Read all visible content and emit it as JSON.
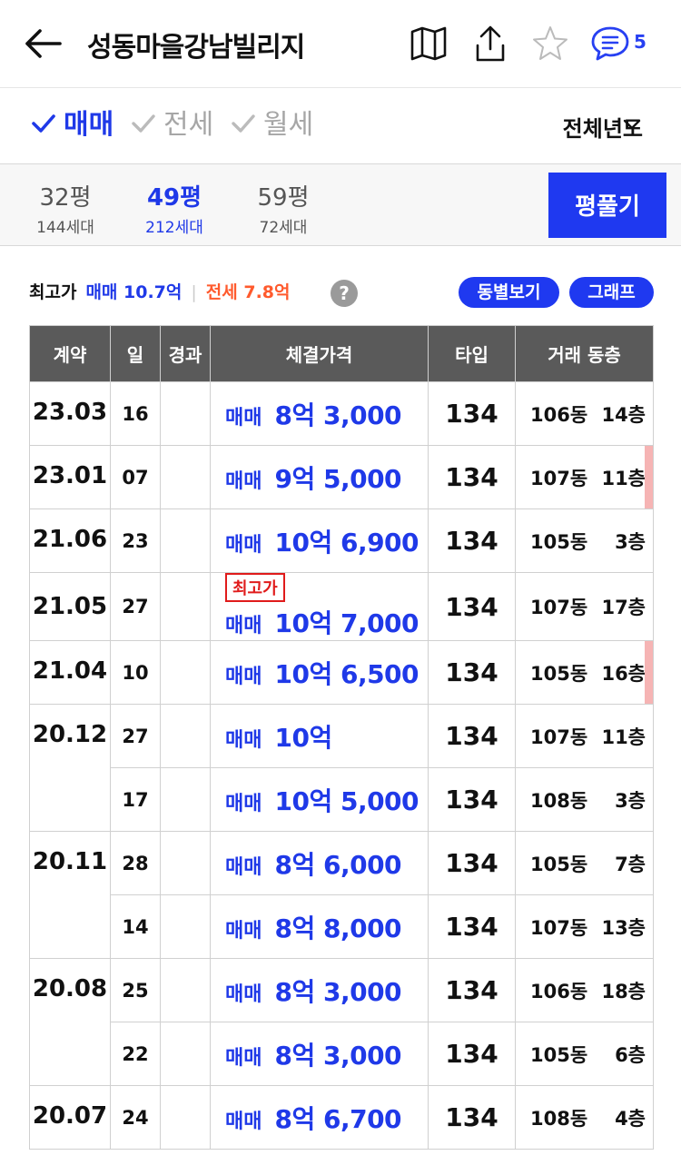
{
  "header": {
    "title": "성동마을강남빌리지",
    "chat_count": "5"
  },
  "tabs": [
    {
      "label": "매매",
      "active": true
    },
    {
      "label": "전세",
      "active": false
    },
    {
      "label": "월세",
      "active": false
    }
  ],
  "year_filter": "전체년도",
  "sizes": [
    {
      "pyeong": "32평",
      "households": "144세대",
      "active": false
    },
    {
      "pyeong": "49평",
      "households": "212세대",
      "active": true
    },
    {
      "pyeong": "59평",
      "households": "72세대",
      "active": false
    }
  ],
  "unfold_label": "평풀기",
  "summary": {
    "label": "최고가",
    "sale": "매매 10.7억",
    "sep": "|",
    "jeonse": "전세 7.8억",
    "help": "?"
  },
  "buttons": {
    "by_building": "동별보기",
    "graph": "그래프"
  },
  "table": {
    "headers": [
      "계약",
      "일",
      "경과",
      "체결가격",
      "타입",
      "거래 동층"
    ],
    "badge_label": "최고가",
    "groups": [
      {
        "date": "23.03",
        "rows": [
          {
            "day": "16",
            "kind": "매매",
            "price": "8억 3,000",
            "type": "134",
            "dong": "106동",
            "floor": "14층"
          }
        ]
      },
      {
        "date": "23.01",
        "rows": [
          {
            "day": "07",
            "kind": "매매",
            "price": "9억 5,000",
            "type": "134",
            "dong": "107동",
            "floor": "11층"
          }
        ]
      },
      {
        "date": "21.06",
        "rows": [
          {
            "day": "23",
            "kind": "매매",
            "price": "10억 6,900",
            "type": "134",
            "dong": "105동",
            "floor": "3층"
          }
        ]
      },
      {
        "date": "21.05",
        "rows": [
          {
            "day": "27",
            "kind": "매매",
            "price": "10억 7,000",
            "type": "134",
            "dong": "107동",
            "floor": "17층"
          }
        ]
      },
      {
        "date": "21.04",
        "rows": [
          {
            "day": "10",
            "kind": "매매",
            "price": "10억 6,500",
            "type": "134",
            "dong": "105동",
            "floor": "16층"
          }
        ]
      },
      {
        "date": "20.12",
        "rows": [
          {
            "day": "27",
            "kind": "매매",
            "price": "10억",
            "type": "134",
            "dong": "107동",
            "floor": "11층"
          },
          {
            "day": "17",
            "kind": "매매",
            "price": "10억 5,000",
            "type": "134",
            "dong": "108동",
            "floor": "3층"
          }
        ]
      },
      {
        "date": "20.11",
        "rows": [
          {
            "day": "28",
            "kind": "매매",
            "price": "8억 6,000",
            "type": "134",
            "dong": "105동",
            "floor": "7층"
          },
          {
            "day": "14",
            "kind": "매매",
            "price": "8억 8,000",
            "type": "134",
            "dong": "107동",
            "floor": "13층"
          }
        ]
      },
      {
        "date": "20.08",
        "rows": [
          {
            "day": "25",
            "kind": "매매",
            "price": "8억 3,000",
            "type": "134",
            "dong": "106동",
            "floor": "18층"
          },
          {
            "day": "22",
            "kind": "매매",
            "price": "8억 3,000",
            "type": "134",
            "dong": "105동",
            "floor": "6층"
          }
        ]
      },
      {
        "date": "20.07",
        "rows": [
          {
            "day": "24",
            "kind": "매매",
            "price": "8억 6,700",
            "type": "134",
            "dong": "108동",
            "floor": "4층"
          }
        ]
      }
    ]
  },
  "colors": {
    "accent": "#1f39f0",
    "jeonse": "#ff5a2d",
    "badge": "#e01b1b",
    "marker": "#f6b4b4",
    "header_bg": "#5a5a5a"
  }
}
